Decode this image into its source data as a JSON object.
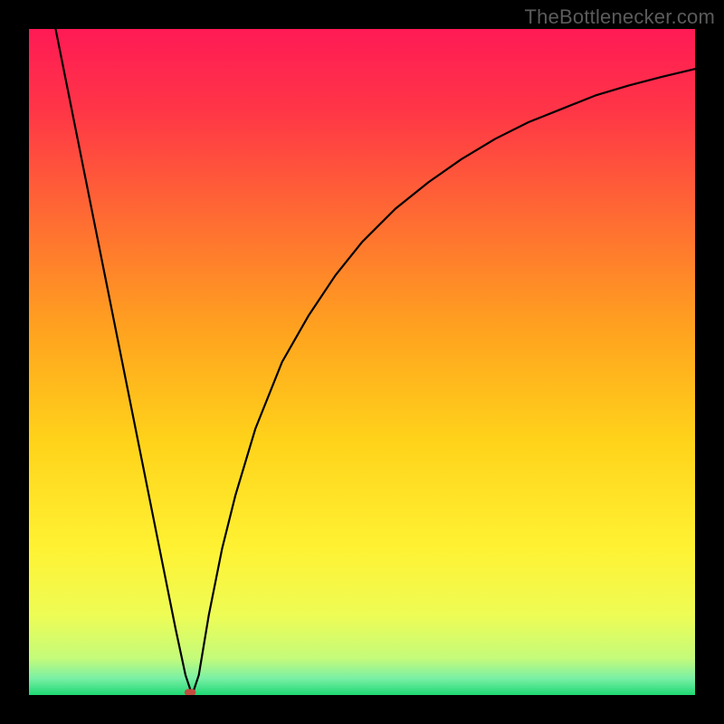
{
  "watermark": "TheBottlenecker.com",
  "chart_data": {
    "type": "line",
    "title": "",
    "xlabel": "",
    "ylabel": "",
    "xlim": [
      0,
      100
    ],
    "ylim": [
      0,
      100
    ],
    "grid": false,
    "legend": false,
    "background_gradient": [
      {
        "stop": 0.0,
        "color": "#ff1a55"
      },
      {
        "stop": 0.12,
        "color": "#ff3547"
      },
      {
        "stop": 0.28,
        "color": "#ff6a33"
      },
      {
        "stop": 0.45,
        "color": "#ffa21f"
      },
      {
        "stop": 0.62,
        "color": "#ffd31a"
      },
      {
        "stop": 0.78,
        "color": "#fff233"
      },
      {
        "stop": 0.88,
        "color": "#eefc55"
      },
      {
        "stop": 0.945,
        "color": "#c4fb7a"
      },
      {
        "stop": 0.975,
        "color": "#7af0a5"
      },
      {
        "stop": 1.0,
        "color": "#1fd873"
      }
    ],
    "series": [
      {
        "name": "curve",
        "stroke": "#000000",
        "stroke_width": 2.2,
        "x": [
          4,
          6,
          8,
          10,
          12,
          14,
          16,
          18,
          20,
          22,
          23.5,
          24.5,
          25.5,
          27,
          29,
          31,
          34,
          38,
          42,
          46,
          50,
          55,
          60,
          65,
          70,
          75,
          80,
          85,
          90,
          95,
          100
        ],
        "y": [
          100,
          90,
          80,
          70,
          60,
          50,
          40,
          30,
          20,
          10,
          3,
          0,
          3,
          12,
          22,
          30,
          40,
          50,
          57,
          63,
          68,
          73,
          77,
          80.5,
          83.5,
          86,
          88,
          90,
          91.5,
          92.8,
          94
        ]
      }
    ],
    "markers": [
      {
        "name": "min-point",
        "shape": "rounded-rect",
        "x": 24.2,
        "y": 0.4,
        "width_pct": 1.7,
        "height_pct": 1.0,
        "fill": "#c44b3f"
      }
    ]
  }
}
